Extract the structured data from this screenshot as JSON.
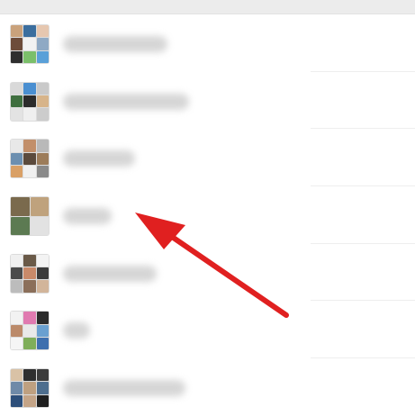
{
  "colors": {
    "arrow": "#e02020",
    "divider": "#eeeeee",
    "topbar": "#ececec"
  },
  "chats": [
    {
      "group_avatar": [
        "#c9a27c",
        "#3b6e9e",
        "#e6c7b0",
        "#6d4c3a",
        "#f2f2f2",
        "#8fa9c4",
        "#2e2e2e",
        "#7bbf6a",
        "#5aa0d8"
      ]
    },
    {
      "group_avatar": [
        "#d9d9d9",
        "#4a8fd1",
        "#c9c9c9",
        "#3f6f3f",
        "#2b2b2b",
        "#d7b48a",
        "#e3e3e3",
        "#efefef",
        "#cccccc"
      ]
    },
    {
      "group_avatar": [
        "#e8e8e8",
        "#c28f6a",
        "#b9b9b9",
        "#6c8fb0",
        "#5b4a3c",
        "#9c7c5a",
        "#d9a066",
        "#f0f0f0",
        "#8a8a8a"
      ]
    },
    {
      "group_avatar": [
        "#7a6a4d",
        "#bfa27d",
        "#5c7a52",
        "#e2e2e2"
      ]
    },
    {
      "group_avatar": [
        "#f0f0f0",
        "#6a5a48",
        "#f3f3f3",
        "#4b4b4b",
        "#c98a6a",
        "#3a3a3a",
        "#bcbcbc",
        "#8b6f5a",
        "#d2b59a"
      ]
    },
    {
      "group_avatar": [
        "#f2f2f2",
        "#e07ab0",
        "#2b2b2b",
        "#bb8a6a",
        "#e9e9e9",
        "#6aa0d0",
        "#f5f5f5",
        "#7fae5a",
        "#3e6fae"
      ]
    },
    {
      "group_avatar": [
        "#d9c2a6",
        "#2f2f2f",
        "#3b3b3b",
        "#6f8aa8",
        "#bfa080",
        "#4e6e8e",
        "#2d4f7a",
        "#c4a487",
        "#1f1f1f"
      ]
    }
  ]
}
